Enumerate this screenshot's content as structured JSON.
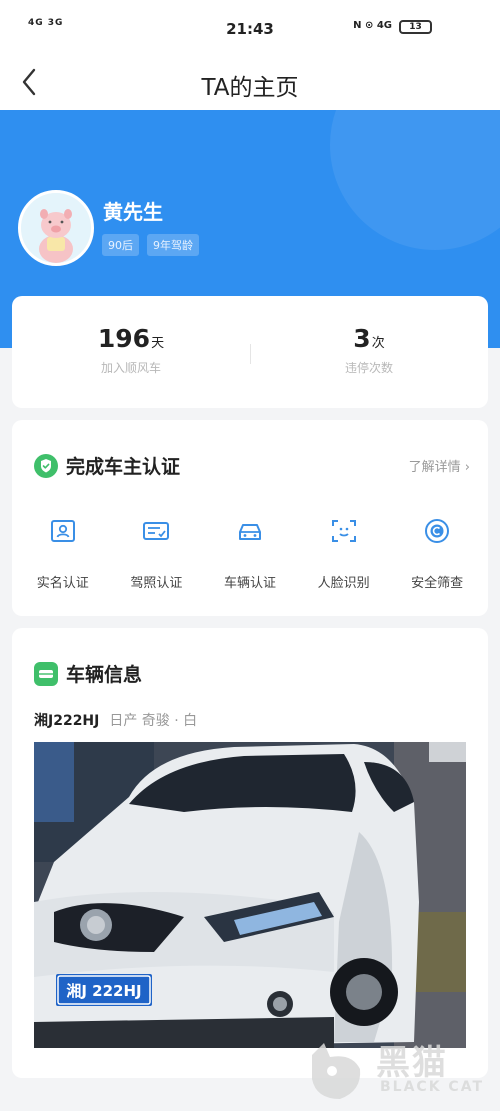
{
  "status_bar": {
    "signal": "4G 3G",
    "time": "21:43",
    "right_icons": "N ⊙ 4G",
    "battery": "13"
  },
  "nav": {
    "title": "TA的主页"
  },
  "profile": {
    "name": "黄先生",
    "tags": [
      "90后",
      "9年驾龄"
    ]
  },
  "stats": [
    {
      "value": "196",
      "unit": "天",
      "label": "加入顺风车"
    },
    {
      "value": "3",
      "unit": "次",
      "label": "违停次数"
    }
  ],
  "certification": {
    "title": "完成车主认证",
    "learn_more": "了解详情 ›",
    "items": [
      {
        "label": "实名认证",
        "icon": "id-card-icon"
      },
      {
        "label": "驾照认证",
        "icon": "license-icon"
      },
      {
        "label": "车辆认证",
        "icon": "car-icon"
      },
      {
        "label": "人脸识别",
        "icon": "face-scan-icon"
      },
      {
        "label": "安全筛查",
        "icon": "security-check-icon"
      }
    ]
  },
  "vehicle": {
    "title": "车辆信息",
    "plate": "湘J222HJ",
    "description": "日产 奇骏 · 白",
    "photo_plate": "湘J 222HJ"
  },
  "watermark": {
    "text_cn": "黑猫",
    "text_en": "BLACK CAT"
  },
  "colors": {
    "primary_blue": "#2f8ff0",
    "icon_blue": "#3a8fe6",
    "cert_green": "#3fbf6a"
  }
}
